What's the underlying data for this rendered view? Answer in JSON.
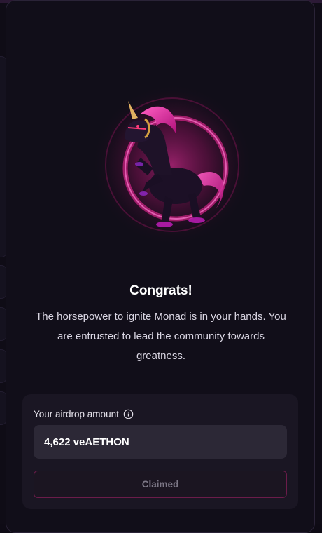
{
  "claim": {
    "title": "Congrats!",
    "description": "The horsepower to ignite Monad is in your hands. You are entrusted to lead the community towards greatness.",
    "hero_image": "pink-unicorn-illustration",
    "airdrop": {
      "label": "Your airdrop amount",
      "info_icon": "info-icon",
      "amount": "4,622 veAETHON"
    },
    "button": {
      "label": "Claimed",
      "disabled": true
    }
  },
  "colors": {
    "background": "#0f0c16",
    "card": "#1a1623",
    "amount_box": "#2c2836",
    "button_border": "#6b1c4a",
    "accent_pink": "#e0228f"
  }
}
